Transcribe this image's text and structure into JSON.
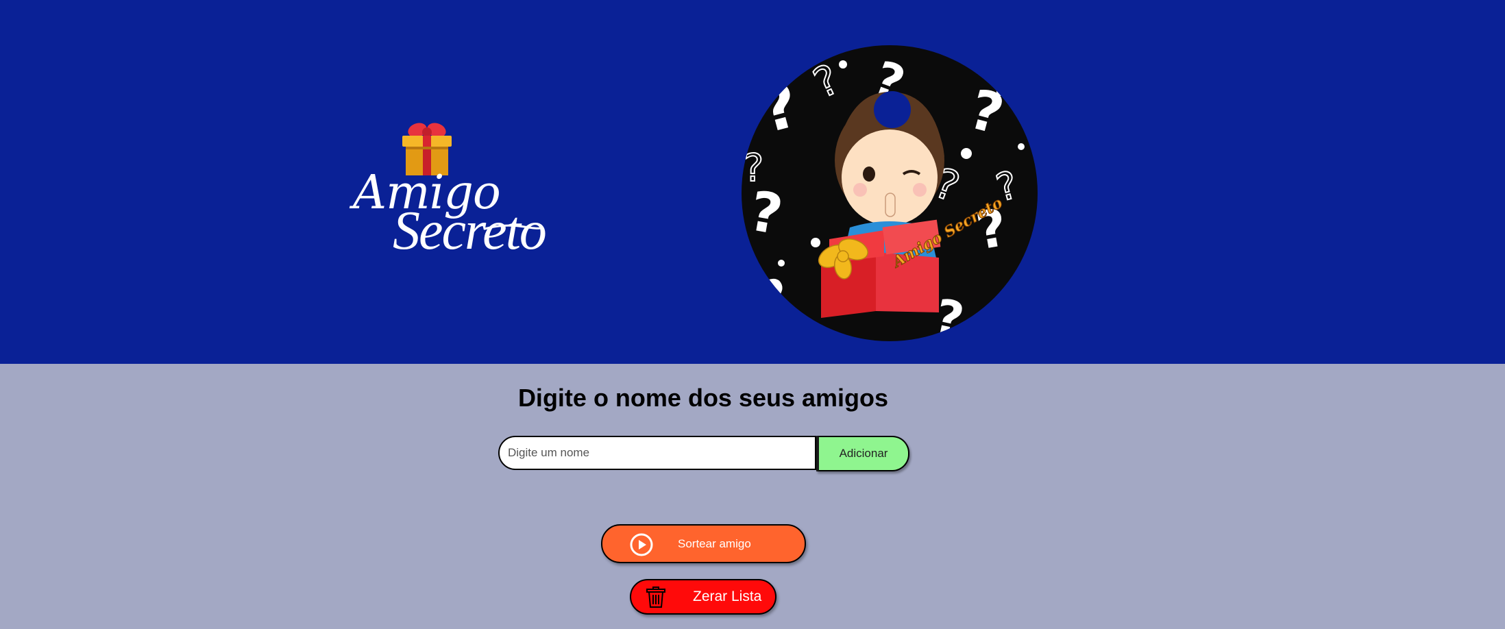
{
  "header": {
    "logo": {
      "word1": "Amigo",
      "word2": "Secreto",
      "gift_icon": "gift-icon"
    },
    "hero_image": "secret-friend-boy-illustration",
    "hero_badge_text": "Amigo Secreto"
  },
  "main": {
    "title": "Digite o nome dos seus amigos",
    "name_input": {
      "value": "",
      "placeholder": "Digite um nome"
    },
    "add_label": "Adicionar",
    "draw_label": "Sortear amigo",
    "draw_icon": "play-circle-icon",
    "clear_label": "Zerar Lista",
    "clear_icon": "trash-icon"
  },
  "colors": {
    "header_bg": "#0a2196",
    "page_bg": "#a3a8c4",
    "add_button": "#8ff58f",
    "draw_button": "#ff642d",
    "clear_button": "#ff0a0a"
  }
}
